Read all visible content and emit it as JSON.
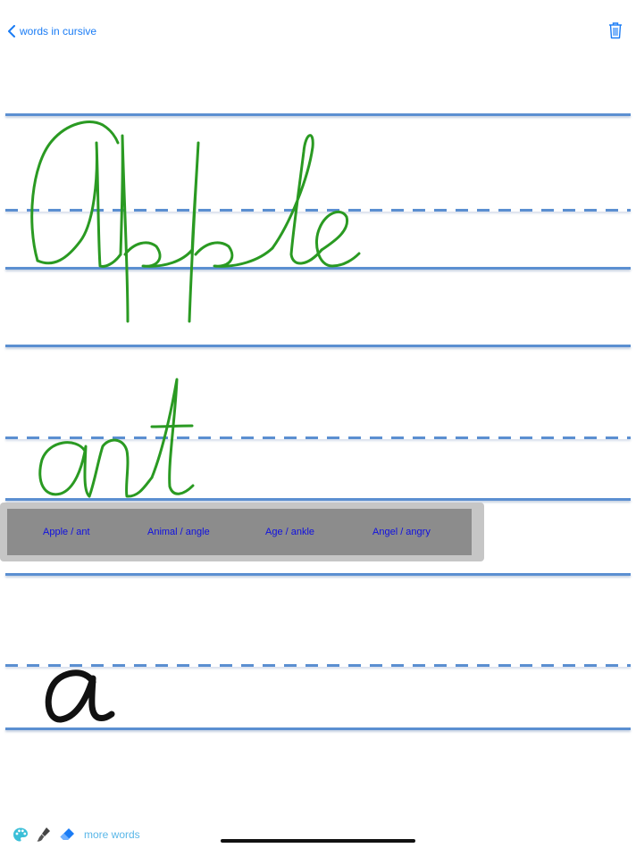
{
  "nav": {
    "back_label": "words in cursive"
  },
  "practice": {
    "word": "Apple",
    "second_word": "ant",
    "user_letter": "a"
  },
  "suggestions": [
    {
      "label": "Apple / ant"
    },
    {
      "label": "Animal / angle"
    },
    {
      "label": "Age / ankle"
    },
    {
      "label": "Angel / angry"
    }
  ],
  "toolbar": {
    "more_words_label": "more words",
    "icons": [
      "palette-icon",
      "brush-icon",
      "eraser-icon"
    ]
  },
  "colors": {
    "accent": "#1a7cf5",
    "guide_line": "#5b8fd1",
    "model_ink": "#2a9a22",
    "user_ink": "#111111",
    "suggestion_text": "#1010e0",
    "more_words": "#5ab7e8"
  }
}
